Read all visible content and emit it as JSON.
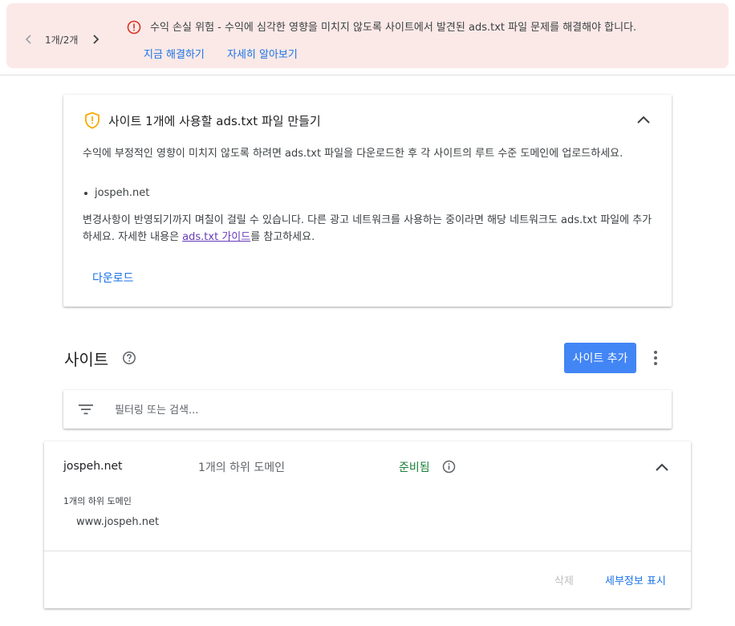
{
  "banner": {
    "pager_count": "1개/2개",
    "message": "수익 손실 위험 - 수익에 심각한 영향을 미치지 않도록 사이트에서 발견된 ads.txt 파일 문제를 해결해야 합니다.",
    "fix_now": "지금 해결하기",
    "learn_more": "자세히 알아보기",
    "colors": {
      "background": "#fbe9e7",
      "error": "#d93025",
      "link": "#1a73e8"
    }
  },
  "ads_card": {
    "title": "사이트 1개에 사용할 ads.txt 파일 만들기",
    "paragraph1": "수익에 부정적인 영향이 미치지 않도록 하려면 ads.txt 파일을 다운로드한 후 각 사이트의 루트 수준 도메인에 업로드하세요.",
    "bullets": [
      "jospeh.net"
    ],
    "paragraph2_before": "변경사항이 반영되기까지 며칠이 걸릴 수 있습니다. 다른 광고 네트워크를 사용하는 중이라면 해당 네트워크도 ads.txt 파일에 추가하세요. 자세한 내용은 ",
    "guide_link": "ads.txt 가이드",
    "paragraph2_after": "를 참고하세요.",
    "download": "다운로드",
    "icon": "shield-warning-icon"
  },
  "sites_section": {
    "title": "사이트",
    "add_button": "사이트 추가",
    "search_placeholder": "필터링 또는 검색...",
    "add_button_color": "#4285f4"
  },
  "site_row": {
    "domain": "jospeh.net",
    "subdomain_count": "1개의 하위 도메인",
    "status": "준비됨",
    "status_color": "#188038",
    "subdomains_label": "1개의 하위 도메인",
    "subdomains": [
      "www.jospeh.net"
    ],
    "delete": "삭제",
    "show_details": "세부정보 표시"
  }
}
